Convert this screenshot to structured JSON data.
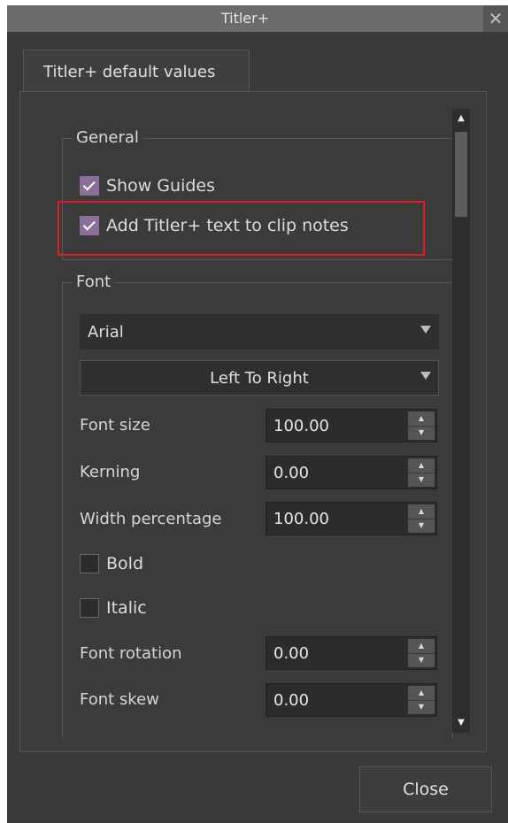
{
  "window": {
    "title": "Titler+",
    "close_glyph": "✕"
  },
  "tab": {
    "label": "Titler+ default values"
  },
  "general": {
    "title": "General",
    "show_guides": {
      "label": "Show Guides",
      "checked": true
    },
    "add_text": {
      "label": "Add Titler+ text to clip notes",
      "checked": true
    }
  },
  "font": {
    "title": "Font",
    "family": "Arial",
    "direction": "Left To Right",
    "size": {
      "label": "Font size",
      "value": "100.00"
    },
    "kerning": {
      "label": "Kerning",
      "value": "0.00"
    },
    "width": {
      "label": "Width percentage",
      "value": "100.00"
    },
    "bold": {
      "label": "Bold",
      "checked": false
    },
    "italic": {
      "label": "Italic",
      "checked": false
    },
    "rotation": {
      "label": "Font rotation",
      "value": "0.00"
    },
    "skew": {
      "label": "Font skew",
      "value": "0.00"
    }
  },
  "close_button": "Close",
  "icons": {
    "up": "▲",
    "down": "▼"
  },
  "colors": {
    "checkbox_accent": "#8a6f9b",
    "highlight": "#e01e2a"
  }
}
